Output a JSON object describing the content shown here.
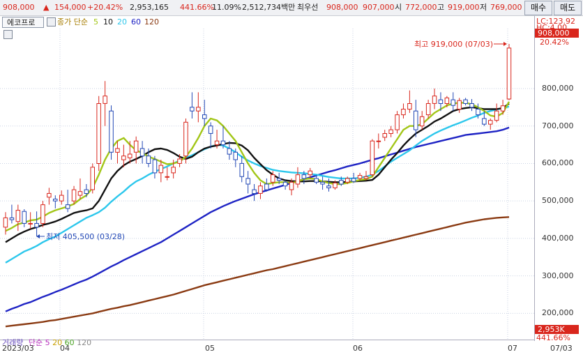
{
  "topbar": {
    "price": "908,000",
    "change_arrow": "▲",
    "change": "154,000",
    "change_pct": "+20.42%",
    "volume": "2,953,165",
    "vol_ratio": "441.66%",
    "turnover": "11.09%",
    "amount": "2,512,734백만",
    "best_label": "최우선",
    "ask": "908,000",
    "bid": "907,000",
    "open_label": "시",
    "open": "772,000",
    "high_label": "고",
    "high": "919,000",
    "low_label": "저",
    "low": "769,000",
    "buy_button": "매수",
    "sell_button": "매도"
  },
  "legend": {
    "stock_name": "에코프로",
    "ma_label": "종가 단순",
    "ma_periods": [
      "5",
      "10",
      "20",
      "60",
      "120"
    ],
    "ma_colors": [
      "#a2c617",
      "#111111",
      "#2cc7ec",
      "#1e23c4",
      "#8a3a12"
    ]
  },
  "annotations": {
    "high_note": "최고 919,000 (07/03)",
    "low_note": "최저 405,500 (03/28)"
  },
  "right_axis": {
    "lc_label": "LC:123.92",
    "lc_sub": "HC:4.00",
    "price_tag": "908,000",
    "pct_tag": "20.42%",
    "vol_tag": "2,953K",
    "vol_pct_tag": "441.66%"
  },
  "volume_legend": {
    "label": "거래량",
    "type": "단순",
    "periods": [
      "5",
      "20",
      "60",
      "120"
    ],
    "colors": [
      "#b52dbb",
      "#c8a000",
      "#4aa324",
      "#888888"
    ]
  },
  "colors": {
    "up": "#d9261c",
    "down": "#2147b5",
    "grid": "#c9d2e3"
  },
  "chart_data": {
    "type": "candlestick",
    "ylim": [
      130000,
      960000
    ],
    "yticks": [
      200000,
      300000,
      400000,
      500000,
      600000,
      700000,
      800000
    ],
    "ytick_labels": [
      "200,000",
      "300,000",
      "400,000",
      "500,000",
      "600,000",
      "700,000",
      "800,000"
    ],
    "xtick_labels": [
      "2023/03",
      "04",
      "05",
      "06",
      "07",
      "07/03"
    ],
    "candles": [
      {
        "o": 430000,
        "h": 470000,
        "l": 410000,
        "c": 455000
      },
      {
        "o": 455000,
        "h": 490000,
        "l": 440000,
        "c": 450000
      },
      {
        "o": 445000,
        "h": 490000,
        "l": 420000,
        "c": 475000
      },
      {
        "o": 472000,
        "h": 478000,
        "l": 430000,
        "c": 440000
      },
      {
        "o": 440000,
        "h": 470000,
        "l": 425000,
        "c": 440000
      },
      {
        "o": 440000,
        "h": 472000,
        "l": 405500,
        "c": 430000
      },
      {
        "o": 440000,
        "h": 500000,
        "l": 430000,
        "c": 490000
      },
      {
        "o": 510000,
        "h": 535000,
        "l": 490000,
        "c": 520000
      },
      {
        "o": 505000,
        "h": 515000,
        "l": 480000,
        "c": 500000
      },
      {
        "o": 500000,
        "h": 528000,
        "l": 490000,
        "c": 515000
      },
      {
        "o": 490000,
        "h": 530000,
        "l": 470000,
        "c": 480000
      },
      {
        "o": 500000,
        "h": 540000,
        "l": 490000,
        "c": 530000
      },
      {
        "o": 515000,
        "h": 560000,
        "l": 505000,
        "c": 525000
      },
      {
        "o": 530000,
        "h": 545000,
        "l": 510000,
        "c": 520000
      },
      {
        "o": 530000,
        "h": 600000,
        "l": 520000,
        "c": 590000
      },
      {
        "o": 600000,
        "h": 780000,
        "l": 580000,
        "c": 760000
      },
      {
        "o": 760000,
        "h": 820000,
        "l": 700000,
        "c": 780000
      },
      {
        "o": 740000,
        "h": 755000,
        "l": 610000,
        "c": 630000
      },
      {
        "o": 630000,
        "h": 660000,
        "l": 600000,
        "c": 640000
      },
      {
        "o": 610000,
        "h": 650000,
        "l": 590000,
        "c": 620000
      },
      {
        "o": 615000,
        "h": 660000,
        "l": 600000,
        "c": 625000
      },
      {
        "o": 630000,
        "h": 672000,
        "l": 600000,
        "c": 660000
      },
      {
        "o": 640000,
        "h": 660000,
        "l": 600000,
        "c": 620000
      },
      {
        "o": 620000,
        "h": 640000,
        "l": 590000,
        "c": 600000
      },
      {
        "o": 610000,
        "h": 620000,
        "l": 560000,
        "c": 575000
      },
      {
        "o": 575000,
        "h": 610000,
        "l": 550000,
        "c": 595000
      },
      {
        "o": 565000,
        "h": 590000,
        "l": 555000,
        "c": 565000
      },
      {
        "o": 575000,
        "h": 610000,
        "l": 560000,
        "c": 590000
      },
      {
        "o": 600000,
        "h": 625000,
        "l": 590000,
        "c": 612000
      },
      {
        "o": 620000,
        "h": 720000,
        "l": 600000,
        "c": 710000
      },
      {
        "o": 750000,
        "h": 790000,
        "l": 720000,
        "c": 740000
      },
      {
        "o": 740000,
        "h": 790000,
        "l": 710000,
        "c": 750000
      },
      {
        "o": 730000,
        "h": 770000,
        "l": 700000,
        "c": 720000
      },
      {
        "o": 700000,
        "h": 710000,
        "l": 640000,
        "c": 680000
      },
      {
        "o": 650000,
        "h": 690000,
        "l": 640000,
        "c": 660000
      },
      {
        "o": 660000,
        "h": 700000,
        "l": 640000,
        "c": 650000
      },
      {
        "o": 640000,
        "h": 660000,
        "l": 610000,
        "c": 625000
      },
      {
        "o": 630000,
        "h": 640000,
        "l": 590000,
        "c": 610000
      },
      {
        "o": 600000,
        "h": 620000,
        "l": 550000,
        "c": 565000
      },
      {
        "o": 560000,
        "h": 580000,
        "l": 520000,
        "c": 545000
      },
      {
        "o": 530000,
        "h": 545000,
        "l": 500000,
        "c": 520000
      },
      {
        "o": 520000,
        "h": 550000,
        "l": 505000,
        "c": 540000
      },
      {
        "o": 545000,
        "h": 560000,
        "l": 525000,
        "c": 530000
      },
      {
        "o": 550000,
        "h": 580000,
        "l": 540000,
        "c": 570000
      },
      {
        "o": 560000,
        "h": 575000,
        "l": 545000,
        "c": 555000
      },
      {
        "o": 550000,
        "h": 555000,
        "l": 530000,
        "c": 540000
      },
      {
        "o": 530000,
        "h": 560000,
        "l": 515000,
        "c": 550000
      },
      {
        "o": 545000,
        "h": 590000,
        "l": 535000,
        "c": 570000
      },
      {
        "o": 570000,
        "h": 580000,
        "l": 545000,
        "c": 560000
      },
      {
        "o": 570000,
        "h": 588000,
        "l": 560000,
        "c": 580000
      },
      {
        "o": 560000,
        "h": 570000,
        "l": 545000,
        "c": 550000
      },
      {
        "o": 550000,
        "h": 565000,
        "l": 530000,
        "c": 545000
      },
      {
        "o": 540000,
        "h": 560000,
        "l": 525000,
        "c": 535000
      },
      {
        "o": 535000,
        "h": 555000,
        "l": 530000,
        "c": 548000
      },
      {
        "o": 555000,
        "h": 565000,
        "l": 540000,
        "c": 545000
      },
      {
        "o": 550000,
        "h": 565000,
        "l": 545000,
        "c": 560000
      },
      {
        "o": 560000,
        "h": 575000,
        "l": 548000,
        "c": 552000
      },
      {
        "o": 560000,
        "h": 575000,
        "l": 555000,
        "c": 568000
      },
      {
        "o": 560000,
        "h": 580000,
        "l": 555000,
        "c": 565000
      },
      {
        "o": 570000,
        "h": 665000,
        "l": 565000,
        "c": 660000
      },
      {
        "o": 660000,
        "h": 680000,
        "l": 640000,
        "c": 660000
      },
      {
        "o": 670000,
        "h": 690000,
        "l": 660000,
        "c": 680000
      },
      {
        "o": 680000,
        "h": 700000,
        "l": 670000,
        "c": 690000
      },
      {
        "o": 690000,
        "h": 740000,
        "l": 680000,
        "c": 730000
      },
      {
        "o": 730000,
        "h": 760000,
        "l": 720000,
        "c": 745000
      },
      {
        "o": 745000,
        "h": 795000,
        "l": 735000,
        "c": 760000
      },
      {
        "o": 740000,
        "h": 770000,
        "l": 670000,
        "c": 690000
      },
      {
        "o": 700000,
        "h": 740000,
        "l": 690000,
        "c": 725000
      },
      {
        "o": 730000,
        "h": 770000,
        "l": 720000,
        "c": 760000
      },
      {
        "o": 760000,
        "h": 800000,
        "l": 745000,
        "c": 780000
      },
      {
        "o": 770000,
        "h": 790000,
        "l": 740000,
        "c": 760000
      },
      {
        "o": 760000,
        "h": 780000,
        "l": 750000,
        "c": 775000
      },
      {
        "o": 770000,
        "h": 790000,
        "l": 740000,
        "c": 755000
      },
      {
        "o": 745000,
        "h": 775000,
        "l": 735000,
        "c": 768000
      },
      {
        "o": 770000,
        "h": 775000,
        "l": 755000,
        "c": 760000
      },
      {
        "o": 760000,
        "h": 772000,
        "l": 740000,
        "c": 750000
      },
      {
        "o": 745000,
        "h": 760000,
        "l": 720000,
        "c": 730000
      },
      {
        "o": 720000,
        "h": 740000,
        "l": 700000,
        "c": 705000
      },
      {
        "o": 705000,
        "h": 720000,
        "l": 690000,
        "c": 715000
      },
      {
        "o": 715000,
        "h": 760000,
        "l": 710000,
        "c": 740000
      },
      {
        "o": 740000,
        "h": 770000,
        "l": 730000,
        "c": 754000
      },
      {
        "o": 772000,
        "h": 919000,
        "l": 769000,
        "c": 908000
      }
    ],
    "ma5": [
      420000,
      428000,
      438000,
      442000,
      448000,
      450000,
      458000,
      468000,
      475000,
      480000,
      485000,
      492000,
      505000,
      515000,
      535000,
      570000,
      610000,
      640000,
      660000,
      668000,
      650000,
      635000,
      628000,
      618000,
      612000,
      605000,
      598000,
      600000,
      605000,
      618000,
      640000,
      668000,
      700000,
      720000,
      715000,
      700000,
      680000,
      660000,
      630000,
      600000,
      575000,
      555000,
      545000,
      548000,
      550000,
      550000,
      548000,
      552000,
      558000,
      560000,
      558000,
      552000,
      548000,
      545000,
      545000,
      548000,
      552000,
      556000,
      558000,
      565000,
      590000,
      615000,
      640000,
      665000,
      690000,
      700000,
      700000,
      705000,
      720000,
      735000,
      745000,
      755000,
      760000,
      762000,
      762000,
      758000,
      750000,
      740000,
      728000,
      725000,
      735000,
      765000
    ],
    "ma10": [
      390000,
      400000,
      410000,
      418000,
      425000,
      430000,
      436000,
      440000,
      445000,
      452000,
      460000,
      468000,
      472000,
      475000,
      480000,
      500000,
      530000,
      560000,
      580000,
      595000,
      605000,
      612000,
      620000,
      630000,
      638000,
      640000,
      636000,
      628000,
      618000,
      612000,
      618000,
      630000,
      640000,
      645000,
      648000,
      652000,
      655000,
      654000,
      648000,
      635000,
      615000,
      598000,
      582000,
      570000,
      560000,
      555000,
      553000,
      552000,
      552000,
      553000,
      553000,
      552000,
      551000,
      550000,
      550000,
      551000,
      552000,
      553000,
      554000,
      556000,
      570000,
      590000,
      610000,
      628000,
      648000,
      665000,
      680000,
      690000,
      700000,
      712000,
      720000,
      730000,
      740000,
      745000,
      748000,
      750000,
      748000,
      745000,
      745000,
      745000,
      748000,
      760000
    ],
    "ma20": [
      335000,
      345000,
      355000,
      365000,
      372000,
      380000,
      390000,
      398000,
      405000,
      415000,
      425000,
      435000,
      445000,
      455000,
      462000,
      470000,
      482000,
      498000,
      512000,
      525000,
      540000,
      552000,
      560000,
      570000,
      578000,
      585000,
      592000,
      600000,
      608000,
      615000,
      622000,
      630000,
      638000,
      645000,
      650000,
      648000,
      640000,
      630000,
      618000,
      608000,
      600000,
      593000,
      588000,
      583000,
      580000,
      578000,
      576000,
      575000,
      574000,
      572000,
      570000,
      567000,
      564000,
      562000,
      560000,
      560000,
      560000,
      562000,
      565000,
      570000,
      580000,
      592000,
      605000,
      615000,
      625000,
      635000,
      648000,
      660000,
      670000,
      680000,
      688000,
      695000,
      702000,
      708000,
      715000,
      722000,
      728000,
      735000,
      740000,
      744000,
      748000,
      752000
    ],
    "ma60": [
      205000,
      212000,
      218000,
      225000,
      230000,
      237000,
      244000,
      250000,
      257000,
      263000,
      270000,
      277000,
      284000,
      290000,
      298000,
      307000,
      316000,
      325000,
      333000,
      342000,
      350000,
      358000,
      366000,
      374000,
      382000,
      390000,
      400000,
      410000,
      420000,
      430000,
      440000,
      450000,
      460000,
      470000,
      478000,
      486000,
      493000,
      500000,
      506000,
      512000,
      518000,
      523000,
      528000,
      533000,
      538000,
      543000,
      548000,
      553000,
      558000,
      563000,
      568000,
      573000,
      578000,
      582000,
      587000,
      592000,
      596000,
      600000,
      605000,
      610000,
      614000,
      619000,
      624000,
      629000,
      634000,
      639000,
      644000,
      648000,
      652000,
      656000,
      660000,
      664000,
      668000,
      672000,
      676000,
      678000,
      680000,
      682000,
      684000,
      686000,
      690000,
      696000
    ],
    "ma120": [
      165000,
      167000,
      169000,
      171000,
      173000,
      175000,
      177000,
      180000,
      182000,
      185000,
      188000,
      191000,
      194000,
      197000,
      200000,
      204000,
      208000,
      212000,
      215000,
      219000,
      222000,
      226000,
      230000,
      234000,
      238000,
      242000,
      246000,
      250000,
      255000,
      260000,
      265000,
      270000,
      275000,
      279000,
      283000,
      287000,
      291000,
      295000,
      299000,
      303000,
      307000,
      311000,
      315000,
      318000,
      322000,
      326000,
      330000,
      334000,
      338000,
      342000,
      346000,
      350000,
      354000,
      358000,
      362000,
      366000,
      370000,
      374000,
      378000,
      382000,
      386000,
      390000,
      394000,
      398000,
      402000,
      406000,
      410000,
      414000,
      418000,
      422000,
      426000,
      430000,
      434000,
      438000,
      442000,
      445000,
      448000,
      451000,
      453000,
      455000,
      456000,
      457000
    ]
  }
}
